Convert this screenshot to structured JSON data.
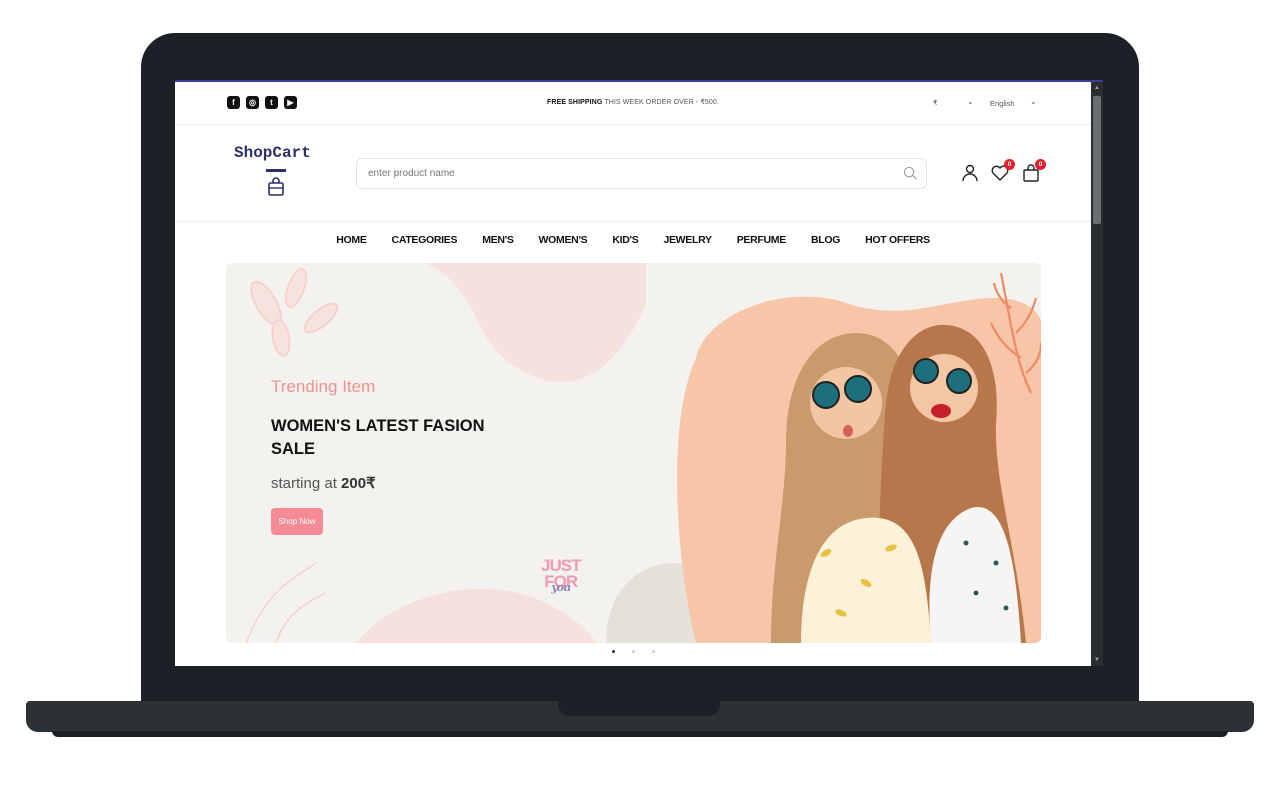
{
  "topbar": {
    "social": [
      {
        "icon": "facebook-icon",
        "glyph": "f"
      },
      {
        "icon": "instagram-icon",
        "glyph": "◎"
      },
      {
        "icon": "twitter-icon",
        "glyph": "t"
      },
      {
        "icon": "youtube-icon",
        "glyph": "▶"
      }
    ],
    "shipping_bold": "FREE SHIPPING",
    "shipping_text": " THIS WEEK ORDER OVER - ₹500.",
    "currency": "₹",
    "language": "English"
  },
  "header": {
    "logo": "ShopCart",
    "search_placeholder": "enter product name",
    "wishlist_count": "0",
    "cart_count": "0"
  },
  "nav": {
    "items": [
      "HOME",
      "CATEGORIES",
      "MEN'S",
      "WOMEN'S",
      "KID'S",
      "JEWELRY",
      "PERFUME",
      "BLOG",
      "HOT OFFERS"
    ]
  },
  "hero": {
    "subtitle": "Trending Item",
    "title": "WOMEN'S LATEST FASION SALE",
    "price_prefix": "starting at ",
    "price": "200₹",
    "cta": "Shop Now",
    "badge_line1": "JUST",
    "badge_line2": "FOR",
    "badge_line3": "you"
  },
  "carousel": {
    "slide_count": 3,
    "active_index": 0
  },
  "colors": {
    "brand": "#2d2f6b",
    "accent": "#f58b97",
    "badge": "#e3202c"
  }
}
